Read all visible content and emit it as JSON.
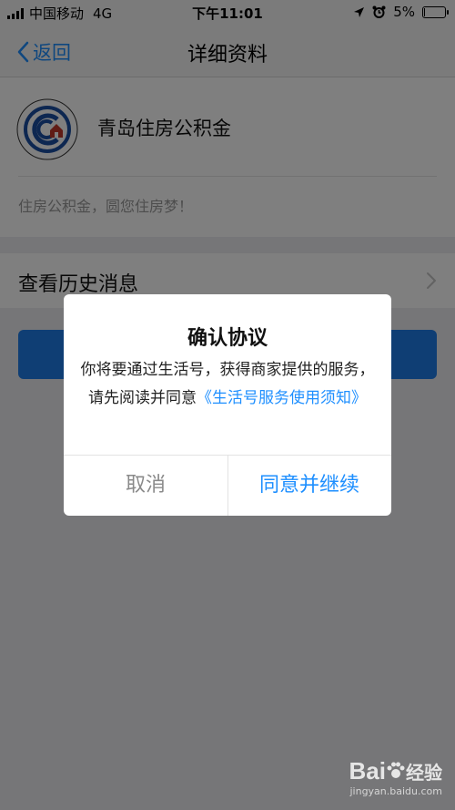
{
  "status_bar": {
    "carrier": "中国移动",
    "network": "4G",
    "time": "下午11:01",
    "battery_percent": "5%",
    "battery_level": 0.05
  },
  "nav": {
    "back_label": "返回",
    "title": "详细资料"
  },
  "profile": {
    "name": "青岛住房公积金",
    "slogan": "住房公积金，圆您住房梦！"
  },
  "history": {
    "label": "查看历史消息"
  },
  "dialog": {
    "title": "确认协议",
    "body": "你将要通过生活号，获得商家提供的服务，请先阅读并同意",
    "link": "《生活号服务使用须知》",
    "cancel_label": "取消",
    "agree_label": "同意并继续"
  },
  "watermark": {
    "brand_left": "Bai",
    "brand_right": "经验",
    "url": "jingyan.baidu.com"
  },
  "colors": {
    "accent": "#1e8fff",
    "button_blue": "#1e7de8"
  }
}
